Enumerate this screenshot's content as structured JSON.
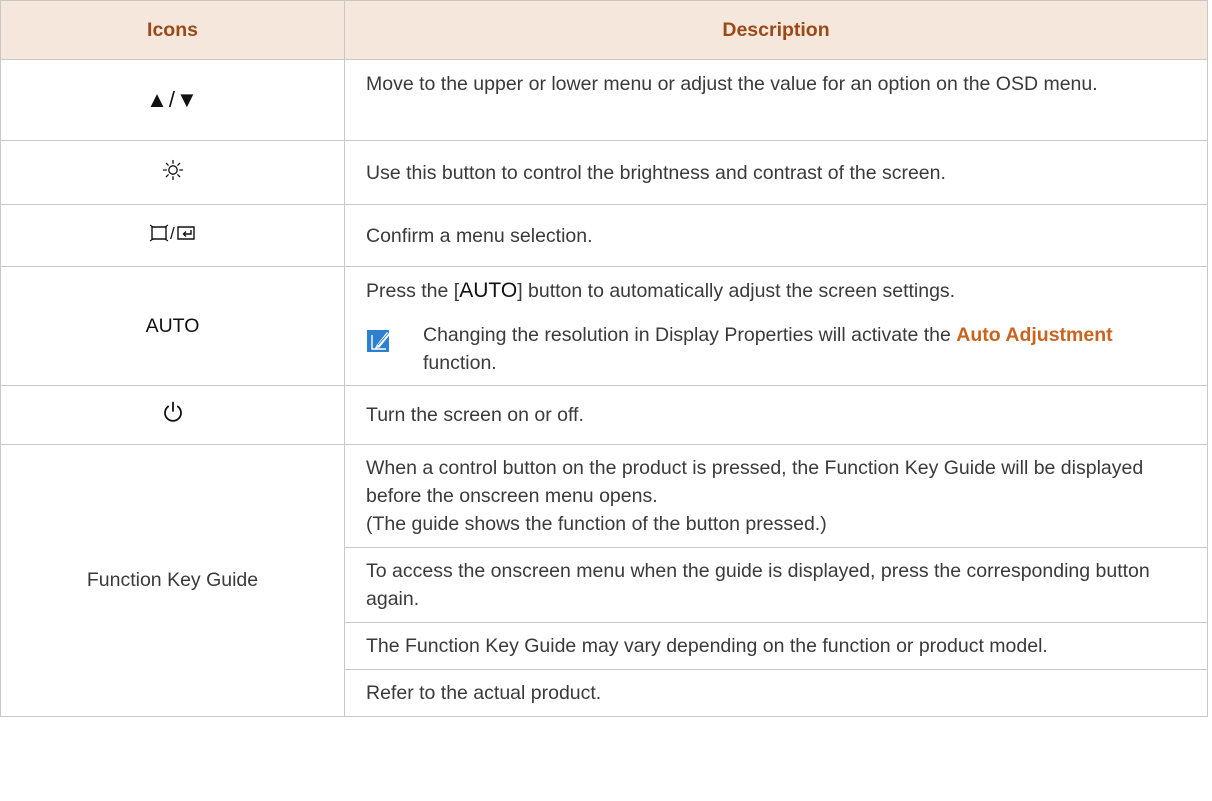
{
  "table": {
    "headers": {
      "icons": "Icons",
      "description": "Description"
    },
    "rows": [
      {
        "icon_text": "▲/▼",
        "description": "Move to the upper or lower menu or adjust the value for an option on the OSD menu."
      },
      {
        "icon_name": "brightness-icon",
        "description": "Use this button to control the brightness and contrast of the screen."
      },
      {
        "icon_name": "menu-enter-icon",
        "description": "Confirm a menu selection."
      },
      {
        "icon_text": "AUTO",
        "description_pre": "Press the [",
        "description_button": "AUTO",
        "description_post": "] button to automatically adjust the screen settings.",
        "note_pre": "Changing the resolution in Display Properties will activate the ",
        "note_highlight": "Auto Adjustment",
        "note_post": " function."
      },
      {
        "icon_name": "power-icon",
        "description": "Turn the screen on or off."
      },
      {
        "icon_text": "Function Key Guide",
        "paragraphs": [
          "When a control button on the product is pressed, the Function Key Guide will be displayed before the onscreen menu opens.",
          "(The guide shows the function of the button pressed.)",
          "To access the onscreen menu when the guide is displayed, press the corresponding button again.",
          "The Function Key Guide may vary depending on the function or product model.",
          "Refer to the actual product."
        ]
      }
    ]
  },
  "colors": {
    "header_bg": "#f6e7dc",
    "header_text": "#9a4a18",
    "highlight": "#c8641e",
    "border": "#c8c8c8"
  }
}
